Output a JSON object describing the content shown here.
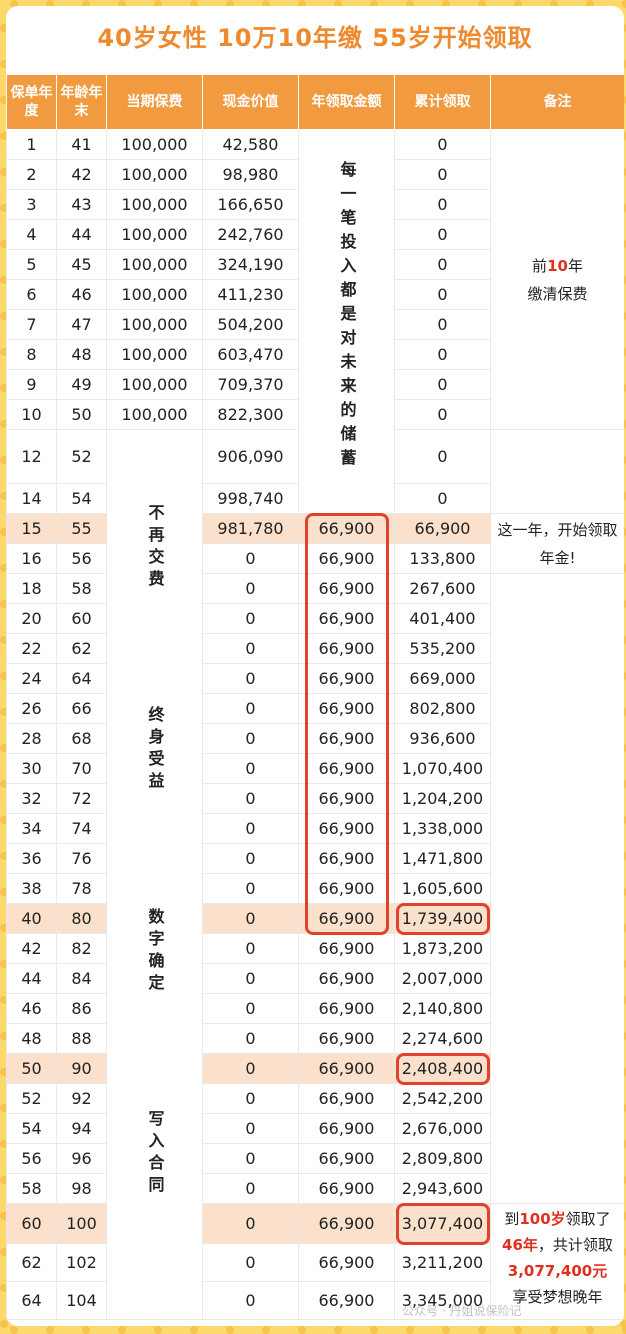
{
  "title": "40岁女性   10万10年缴   55岁开始领取",
  "headers": [
    "保单年度",
    "年龄年末",
    "当期保费",
    "现金价值",
    "年领取金额",
    "累计领取",
    "备注"
  ],
  "rows": [
    [
      "1",
      "41",
      "100,000",
      "42,580",
      "0"
    ],
    [
      "2",
      "42",
      "100,000",
      "98,980",
      "0"
    ],
    [
      "3",
      "43",
      "100,000",
      "166,650",
      "0"
    ],
    [
      "4",
      "44",
      "100,000",
      "242,760",
      "0"
    ],
    [
      "5",
      "45",
      "100,000",
      "324,190",
      "0"
    ],
    [
      "6",
      "46",
      "100,000",
      "411,230",
      "0"
    ],
    [
      "7",
      "47",
      "100,000",
      "504,200",
      "0"
    ],
    [
      "8",
      "48",
      "100,000",
      "603,470",
      "0"
    ],
    [
      "9",
      "49",
      "100,000",
      "709,370",
      "0"
    ],
    [
      "10",
      "50",
      "100,000",
      "822,300",
      "0"
    ],
    [
      "12",
      "52",
      "",
      "906,090",
      "0"
    ],
    [
      "14",
      "54",
      "",
      "998,740",
      "0"
    ],
    [
      "15",
      "55",
      "",
      "981,780",
      "66,900",
      "66,900"
    ],
    [
      "16",
      "56",
      "",
      "0",
      "66,900",
      "133,800"
    ],
    [
      "18",
      "58",
      "",
      "0",
      "66,900",
      "267,600"
    ],
    [
      "20",
      "60",
      "",
      "0",
      "66,900",
      "401,400"
    ],
    [
      "22",
      "62",
      "",
      "0",
      "66,900",
      "535,200"
    ],
    [
      "24",
      "64",
      "",
      "0",
      "66,900",
      "669,000"
    ],
    [
      "26",
      "66",
      "",
      "0",
      "66,900",
      "802,800"
    ],
    [
      "28",
      "68",
      "",
      "0",
      "66,900",
      "936,600"
    ],
    [
      "30",
      "70",
      "",
      "0",
      "66,900",
      "1,070,400"
    ],
    [
      "32",
      "72",
      "",
      "0",
      "66,900",
      "1,204,200"
    ],
    [
      "34",
      "74",
      "",
      "0",
      "66,900",
      "1,338,000"
    ],
    [
      "36",
      "76",
      "",
      "0",
      "66,900",
      "1,471,800"
    ],
    [
      "38",
      "78",
      "",
      "0",
      "66,900",
      "1,605,600"
    ],
    [
      "40",
      "80",
      "",
      "0",
      "66,900",
      "1,739,400"
    ],
    [
      "42",
      "82",
      "",
      "0",
      "66,900",
      "1,873,200"
    ],
    [
      "44",
      "84",
      "",
      "0",
      "66,900",
      "2,007,000"
    ],
    [
      "46",
      "86",
      "",
      "0",
      "66,900",
      "2,140,800"
    ],
    [
      "48",
      "88",
      "",
      "0",
      "66,900",
      "2,274,600"
    ],
    [
      "50",
      "90",
      "",
      "0",
      "66,900",
      "2,408,400"
    ],
    [
      "52",
      "92",
      "",
      "0",
      "66,900",
      "2,542,200"
    ],
    [
      "54",
      "94",
      "",
      "0",
      "66,900",
      "2,676,000"
    ],
    [
      "56",
      "96",
      "",
      "0",
      "66,900",
      "2,809,800"
    ],
    [
      "58",
      "98",
      "",
      "0",
      "66,900",
      "2,943,600"
    ],
    [
      "60",
      "100",
      "",
      "0",
      "66,900",
      "3,077,400"
    ],
    [
      "62",
      "102",
      "",
      "0",
      "66,900",
      "3,211,200"
    ],
    [
      "64",
      "104",
      "",
      "0",
      "66,900",
      "3,345,000"
    ]
  ],
  "highlight_rows": [
    12,
    25,
    30,
    35
  ],
  "vertical_slogan_invest": "每一笔投入都是对未来的储蓄",
  "vertical_slogan_1": "不再交费",
  "vertical_slogan_2": "终身受益",
  "vertical_slogan_3": "数字确定",
  "vertical_slogan_4": "写入合同",
  "note_pay": {
    "pre": "前",
    "num": "10",
    "post": "年",
    "line2": "缴清保费"
  },
  "note_start": "这一年，开始领取年金!",
  "note_end": {
    "a": "到",
    "b": "100岁",
    "c": "领取了",
    "d": "46年",
    "e": "，共计领取",
    "f": "3,077,400元",
    "g": "享受梦想晚年"
  },
  "watermark": "公众号 · 丹姐说保险记",
  "colors": {
    "accent": "#ee8a2e",
    "header_bg": "#f29a3f",
    "highlight": "#fbe1cc",
    "red": "#e0301e"
  }
}
